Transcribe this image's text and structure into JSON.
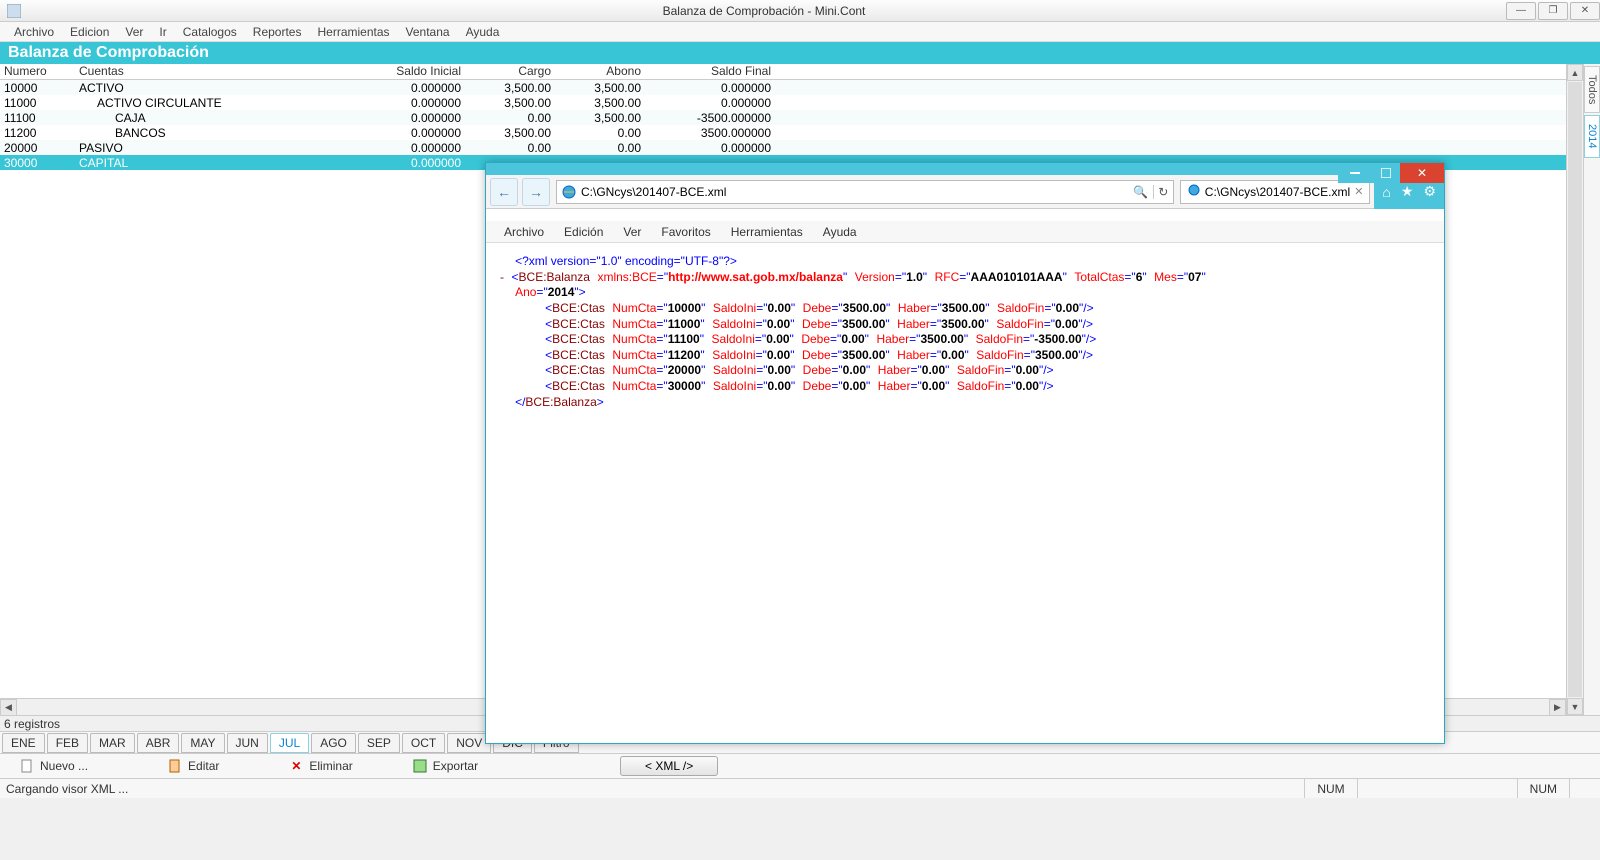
{
  "window": {
    "title": "Balanza de Comprobación - Mini.Cont"
  },
  "menu": [
    "Archivo",
    "Edicion",
    "Ver",
    "Ir",
    "Catalogos",
    "Reportes",
    "Herramientas",
    "Ventana",
    "Ayuda"
  ],
  "page_title": "Balanza de Comprobación",
  "columns": {
    "numero": "Numero",
    "cuentas": "Cuentas",
    "saldo_inicial": "Saldo Inicial",
    "cargo": "Cargo",
    "abono": "Abono",
    "saldo_final": "Saldo Final"
  },
  "rows": [
    {
      "num": "10000",
      "cta": "ACTIVO",
      "indent": 0,
      "si": "0.000000",
      "cargo": "3,500.00",
      "abono": "3,500.00",
      "sf": "0.000000"
    },
    {
      "num": "11000",
      "cta": "ACTIVO CIRCULANTE",
      "indent": 1,
      "si": "0.000000",
      "cargo": "3,500.00",
      "abono": "3,500.00",
      "sf": "0.000000"
    },
    {
      "num": "11100",
      "cta": "CAJA",
      "indent": 2,
      "si": "0.000000",
      "cargo": "0.00",
      "abono": "3,500.00",
      "sf": "-3500.000000"
    },
    {
      "num": "11200",
      "cta": "BANCOS",
      "indent": 2,
      "si": "0.000000",
      "cargo": "3,500.00",
      "abono": "0.00",
      "sf": "3500.000000"
    },
    {
      "num": "20000",
      "cta": "PASIVO",
      "indent": 0,
      "si": "0.000000",
      "cargo": "0.00",
      "abono": "0.00",
      "sf": "0.000000"
    },
    {
      "num": "30000",
      "cta": "CAPITAL",
      "indent": 0,
      "si": "0.000000",
      "cargo": "",
      "abono": "",
      "sf": "",
      "selected": true
    }
  ],
  "side_tabs": [
    "Todos",
    "2014"
  ],
  "side_active": 1,
  "status_count": "6 registros",
  "months": [
    "ENE",
    "FEB",
    "MAR",
    "ABR",
    "MAY",
    "JUN",
    "JUL",
    "AGO",
    "SEP",
    "OCT",
    "NOV",
    "DIC",
    "Filtro"
  ],
  "month_active": 6,
  "toolbar": {
    "nuevo": "Nuevo ...",
    "editar": "Editar",
    "eliminar": "Eliminar",
    "exportar": "Exportar",
    "xml": "< XML />"
  },
  "statusbar": {
    "loading": "Cargando visor XML ...",
    "num": "NUM",
    "num2": "NUM"
  },
  "ie": {
    "url": "C:\\GNcys\\201407-BCE.xml",
    "tab": "C:\\GNcys\\201407-BCE.xml",
    "menu": [
      "Archivo",
      "Edición",
      "Ver",
      "Favoritos",
      "Herramientas",
      "Ayuda"
    ],
    "xml": {
      "decl": "<?xml version=\"1.0\" encoding=\"UTF-8\"?>",
      "root_open_tag": "BCE:Balanza",
      "xmlns_label": "xmlns:BCE",
      "xmlns": "http://www.sat.gob.mx/balanza",
      "attrs": [
        {
          "n": "Version",
          "v": "1.0"
        },
        {
          "n": "RFC",
          "v": "AAA010101AAA"
        },
        {
          "n": "TotalCtas",
          "v": "6"
        },
        {
          "n": "Mes",
          "v": "07"
        },
        {
          "n": "Ano",
          "v": "2014"
        }
      ],
      "ctas_tag": "BCE:Ctas",
      "lines": [
        {
          "NumCta": "10000",
          "SaldoIni": "0.00",
          "Debe": "3500.00",
          "Haber": "3500.00",
          "SaldoFin": "0.00"
        },
        {
          "NumCta": "11000",
          "SaldoIni": "0.00",
          "Debe": "3500.00",
          "Haber": "3500.00",
          "SaldoFin": "0.00"
        },
        {
          "NumCta": "11100",
          "SaldoIni": "0.00",
          "Debe": "0.00",
          "Haber": "3500.00",
          "SaldoFin": "-3500.00"
        },
        {
          "NumCta": "11200",
          "SaldoIni": "0.00",
          "Debe": "3500.00",
          "Haber": "0.00",
          "SaldoFin": "3500.00"
        },
        {
          "NumCta": "20000",
          "SaldoIni": "0.00",
          "Debe": "0.00",
          "Haber": "0.00",
          "SaldoFin": "0.00"
        },
        {
          "NumCta": "30000",
          "SaldoIni": "0.00",
          "Debe": "0.00",
          "Haber": "0.00",
          "SaldoFin": "0.00"
        }
      ],
      "close_tag": "BCE:Balanza"
    }
  }
}
